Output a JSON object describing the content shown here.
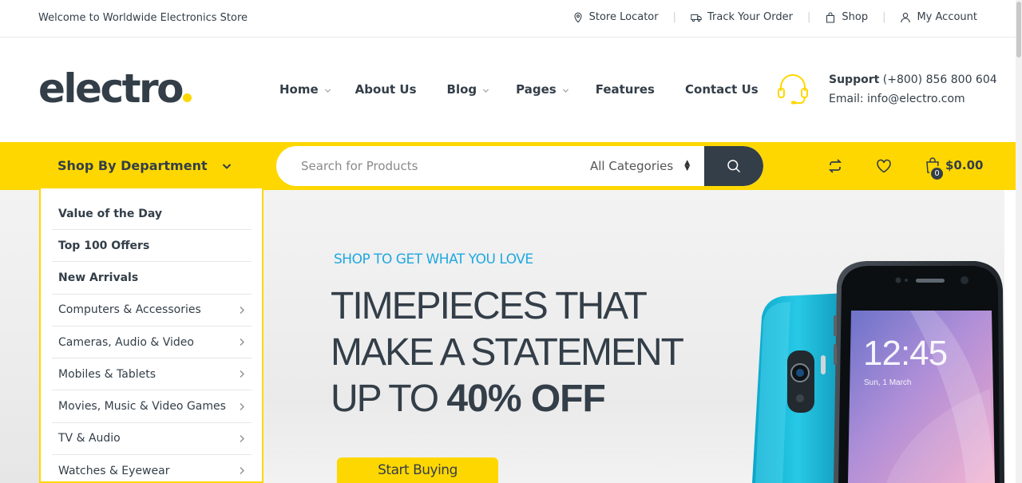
{
  "topbar": {
    "welcome": "Welcome to Worldwide Electronics Store",
    "links": {
      "store_locator": "Store Locator",
      "track_order": "Track Your Order",
      "shop": "Shop",
      "my_account": "My Account"
    },
    "separator": "|"
  },
  "header": {
    "logo": "electro",
    "nav": {
      "home": "Home",
      "about": "About Us",
      "blog": "Blog",
      "pages": "Pages",
      "features": "Features",
      "contact": "Contact Us"
    },
    "support": {
      "label": "Support",
      "phone": "(+800) 856 800 604",
      "email": "Email: info@electro.com"
    }
  },
  "searchbar": {
    "department_label": "Shop By Department",
    "search_placeholder": "Search for Products",
    "category_selected": "All Categories",
    "cart_count": "0",
    "cart_total": "$0.00",
    "icons": [
      "compare-icon",
      "wishlist-heart-icon",
      "shopping-bag-icon",
      "search-icon"
    ]
  },
  "departments": [
    {
      "label": "Value of the Day",
      "bold": true,
      "has_arrow": false
    },
    {
      "label": "Top 100 Offers",
      "bold": true,
      "has_arrow": false
    },
    {
      "label": "New Arrivals",
      "bold": true,
      "has_arrow": false
    },
    {
      "label": "Computers & Accessories",
      "bold": false,
      "has_arrow": true
    },
    {
      "label": "Cameras, Audio & Video",
      "bold": false,
      "has_arrow": true
    },
    {
      "label": "Mobiles & Tablets",
      "bold": false,
      "has_arrow": true
    },
    {
      "label": "Movies, Music & Video Games",
      "bold": false,
      "has_arrow": true
    },
    {
      "label": "TV & Audio",
      "bold": false,
      "has_arrow": true
    },
    {
      "label": "Watches & Eyewear",
      "bold": false,
      "has_arrow": true
    }
  ],
  "hero": {
    "kicker": "SHOP TO GET WHAT YOU LOVE",
    "line1": "TIMEPIECES THAT",
    "line2": "MAKE A STATEMENT",
    "line3_prefix": "UP TO",
    "line3_bold": "40% OFF",
    "cta": "Start Buying",
    "phone_time": "12:45",
    "phone_date": "Sun, 1 March"
  },
  "colors": {
    "accent": "#fed700",
    "dark": "#333e48",
    "kicker_blue": "#1fa8e0"
  }
}
